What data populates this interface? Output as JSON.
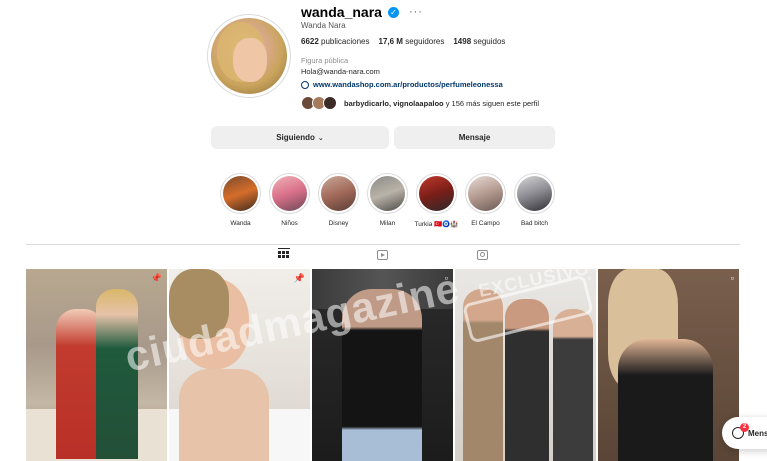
{
  "profile": {
    "username": "wanda_nara",
    "fullname": "Wanda Nara",
    "category": "Figura pública",
    "email": "Hola@wanda-nara.com",
    "link": "www.wandashop.com.ar/productos/perfumeleonessa",
    "followed_by_names": "barbydicarlo, vignolaapaloo",
    "followed_by_suffix": " y 156 más siguen este perfil"
  },
  "stats": {
    "posts_count": "6622",
    "posts_label": "publicaciones",
    "followers_count": "17,6 M",
    "followers_label": "seguidores",
    "following_count": "1498",
    "following_label": "seguidos"
  },
  "buttons": {
    "following": "Siguiendo",
    "message": "Mensaje"
  },
  "highlights": [
    {
      "label": "Wanda"
    },
    {
      "label": "Niños"
    },
    {
      "label": "Disney"
    },
    {
      "label": "Milan"
    },
    {
      "label": "Turkia 🇹🇷🧿🏰"
    },
    {
      "label": "El Campo"
    },
    {
      "label": "Bad bitch"
    }
  ],
  "watermark": "ciudadmagazine",
  "watermark_stamp": "EXCLUSIVO",
  "messages": {
    "label": "Mens",
    "count": "2"
  },
  "icons": {
    "verified": "verified-badge-icon",
    "more": "more-options-icon",
    "link": "link-icon",
    "grid": "grid-icon",
    "reels": "reels-icon",
    "tagged": "tagged-icon",
    "pin": "pin-icon",
    "reel": "reel-indicator-icon",
    "chevron": "chevron-down-icon",
    "messenger": "messenger-icon"
  },
  "colors": {
    "accent": "#0095f6",
    "link": "#00376b",
    "button_bg": "#efefef",
    "badge": "#ff3040"
  }
}
